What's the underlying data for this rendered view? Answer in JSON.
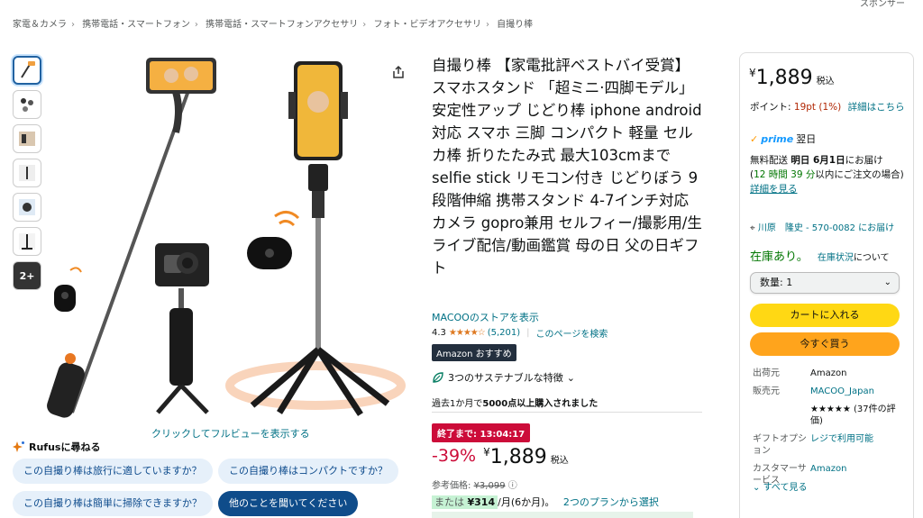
{
  "sponsor": "スポンサー",
  "breadcrumb": [
    "家電＆カメラ",
    "携帯電話・スマートフォン",
    "携帯電話・スマートフォンアクセサリ",
    "フォト・ビデオアクセサリ",
    "自撮り棒"
  ],
  "gallery": {
    "more_label": "2+",
    "fullview_link": "クリックしてフルビューを表示する"
  },
  "rufus": {
    "title": "Rufusに尋ねる",
    "questions": [
      "この自撮り棒は旅行に適していますか？",
      "この自撮り棒はコンパクトですか？",
      "この自撮り棒は簡単に掃除できますか？"
    ],
    "ask_other": "他のことを聞いてください"
  },
  "product": {
    "title": "自撮り棒 【家電批評ベストバイ受賞】 スマホスタンド 「超ミニ·四脚モデル」安定性アップ じどり棒 iphone android対応 スマホ 三脚 コンパクト 軽量 セルカ棒 折りたたみ式 最大103cmまで selfie stick リモコン付き じどりぼう 9段階伸縮 携帯スタンド 4-7インチ対応 カメラ gopro兼用 セルフィー/撮影用/生ライブ配信/動画鑑賞 母の日 父の日ギフト",
    "store_link": "MACOOのストアを表示",
    "rating": "4.3",
    "stars": "★★★★☆",
    "reviews": "(5,201)",
    "search_page": "このページを検索",
    "choice_badge": "Amazon おすすめ",
    "sustain": "3つのサステナブルな特徴",
    "bought_text": "過去1か月で",
    "bought_bold": "5000点以上購入されました",
    "deal": "終了まで: 13:04:17",
    "discount": "-39%",
    "yen": "¥",
    "price": "1,889",
    "tax": "税込",
    "ref_label": "参考価格:",
    "ref_price": "¥3,099",
    "install_prefix": "または",
    "install_amount": "¥314",
    "install_suffix": "/月(6か月)。",
    "install_link": "2つのプランから選択"
  },
  "buybox": {
    "yen": "¥",
    "price": "1,889",
    "tax": "税込",
    "points_label": "ポイント:",
    "points_value": "19pt",
    "points_pct": "(1%)",
    "points_link": "詳細はこちら",
    "prime_word": "prime",
    "prime_day": "翌日",
    "delivery_1": "無料配送",
    "delivery_date": "明日 6月1日",
    "delivery_2": "にお届け",
    "countdown": "12 時間 39 分",
    "delivery_3": "以内にご注文の場合",
    "details_link": "詳細を見る",
    "address": "川原　隆史 - 570-0082 にお届け",
    "stock": "在庫あり。",
    "stock_link": "在庫状況",
    "stock_text": "について",
    "qty_label": "数量: 1",
    "cart_button": "カートに入れる",
    "buy_button": "今すぐ買う",
    "info": [
      {
        "k": "出荷元",
        "v": "Amazon"
      },
      {
        "k": "販売元",
        "v": "MACOO_Japan"
      },
      {
        "k": "",
        "v": "★★★★★ (37件の評価)"
      },
      {
        "k": "ギフトオプション",
        "v": "レジで利用可能"
      },
      {
        "k": "カスタマーサービス",
        "v": "Amazon"
      }
    ],
    "see_all": "すべて見る"
  }
}
